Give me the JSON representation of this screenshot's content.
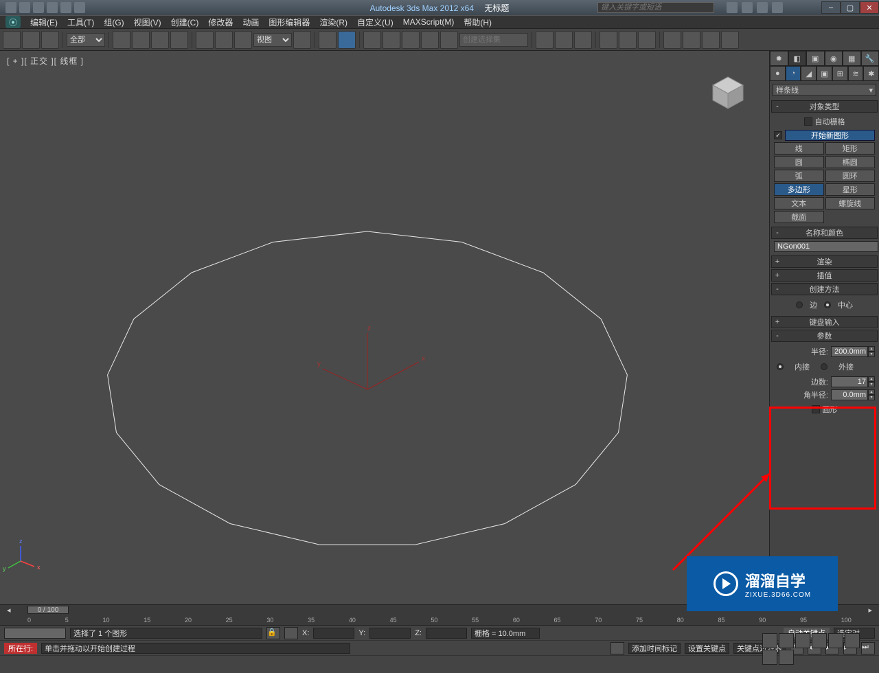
{
  "titlebar": {
    "app_title": "Autodesk 3ds Max  2012 x64",
    "doc_title": "无标题",
    "search_placeholder": "键入关键字或短语"
  },
  "menubar": {
    "items": [
      "编辑(E)",
      "工具(T)",
      "组(G)",
      "视图(V)",
      "创建(C)",
      "修改器",
      "动画",
      "图形编辑器",
      "渲染(R)",
      "自定义(U)",
      "MAXScript(M)",
      "帮助(H)"
    ]
  },
  "toolbar": {
    "selset_all": "全部",
    "view_dd": "视图",
    "createset_ph": "创建选择集"
  },
  "viewport": {
    "label": "[ + ][ 正交 ][ 线框 ]",
    "axes": {
      "x": "x",
      "y": "y",
      "z": "z"
    }
  },
  "cmdpanel": {
    "dropdown": "样条线",
    "obj_type": {
      "title": "对象类型",
      "autogrid": "自动栅格",
      "newshape": "开始新图形",
      "buttons": [
        "线",
        "矩形",
        "圆",
        "椭圆",
        "弧",
        "圆环",
        "多边形",
        "星形",
        "文本",
        "螺旋线",
        "截面"
      ]
    },
    "name_color": {
      "title": "名称和颜色",
      "name": "NGon001"
    },
    "render_title": "渲染",
    "interp_title": "插值",
    "method": {
      "title": "创建方法",
      "edge": "边",
      "center": "中心"
    },
    "kbd_title": "键盘输入",
    "params": {
      "title": "参数",
      "radius_label": "半径:",
      "radius": "200.0mm",
      "inscribed": "内接",
      "circum": "外接",
      "sides_label": "边数:",
      "sides": "17",
      "corner_label": "角半径:",
      "corner": "0.0mm",
      "circular": "圆形"
    }
  },
  "timeline": {
    "pos": "0 / 100",
    "ticks": [
      "0",
      "5",
      "10",
      "15",
      "20",
      "25",
      "30",
      "35",
      "40",
      "45",
      "50",
      "55",
      "60",
      "65",
      "70",
      "75",
      "80",
      "85",
      "90",
      "95",
      "100"
    ]
  },
  "status": {
    "selinfo": "选择了 1 个图形",
    "x": "X:",
    "y": "Y:",
    "z": "Z:",
    "grid": "栅格 = 10.0mm",
    "autokey": "自动关键点",
    "selkey": "选定对",
    "prompt": "单击并拖动以开始创建过程",
    "line_label": "所在行:",
    "addtime": "添加时间标记",
    "setkey": "设置关键点",
    "keyfilter": "关键点过滤器"
  },
  "watermark": {
    "brand": "溜溜自学",
    "url": "ZIXUE.3D66.COM"
  },
  "polygon": {
    "sides": 17
  }
}
